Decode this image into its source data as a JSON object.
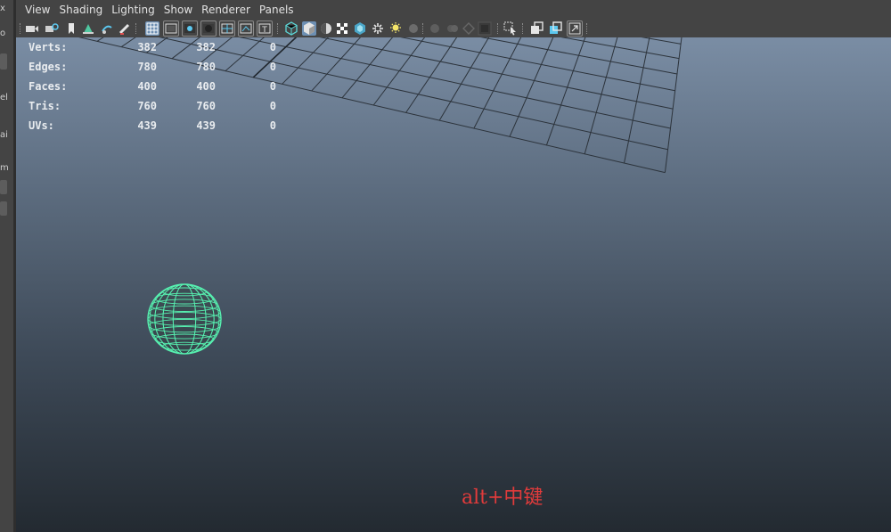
{
  "left_panel": {
    "fragments": [
      "x",
      "o",
      "el",
      "ai",
      "m"
    ]
  },
  "menubar": {
    "items": [
      "View",
      "Shading",
      "Lighting",
      "Show",
      "Renderer",
      "Panels"
    ]
  },
  "toolbar": {
    "icons": [
      "camera-icon",
      "camera-attributes-icon",
      "bookmark-icon",
      "image-plane-icon",
      "2d-pan-zoom-icon",
      "grease-pencil-icon",
      "grid-icon",
      "film-gate-icon",
      "resolution-gate-icon",
      "gate-mask-icon",
      "field-chart-icon",
      "safe-title-icon",
      "wireframe-icon",
      "smooth-shade-icon",
      "shade-wire-icon",
      "xray-icon",
      "textured-icon",
      "use-all-lights-icon",
      "shadows-icon",
      "screen-space-ao-icon",
      "motion-blur-icon",
      "multisample-aa-icon",
      "depth-of-field-icon",
      "isolate-select-icon",
      "xray-active-icon",
      "xray-joints-icon",
      "xray-components-icon",
      "hud-toggle-icon"
    ],
    "accent": "#6d8fb3"
  },
  "hud": {
    "rows": [
      {
        "label": "Verts:",
        "v1": "382",
        "v2": "382",
        "v3": "0"
      },
      {
        "label": "Edges:",
        "v1": "780",
        "v2": "780",
        "v3": "0"
      },
      {
        "label": "Faces:",
        "v1": "400",
        "v2": "400",
        "v3": "0"
      },
      {
        "label": "Tris:",
        "v1": "760",
        "v2": "760",
        "v3": "0"
      },
      {
        "label": "UVs:",
        "v1": "439",
        "v2": "439",
        "v3": "0"
      }
    ]
  },
  "viewport": {
    "object": "sphere",
    "wire_color": "#57f0b0",
    "grid_color": "#2c333b",
    "grid_axis_color": "#1f252b"
  },
  "caption": "alt+中键",
  "caption_color": "#e23b3b"
}
